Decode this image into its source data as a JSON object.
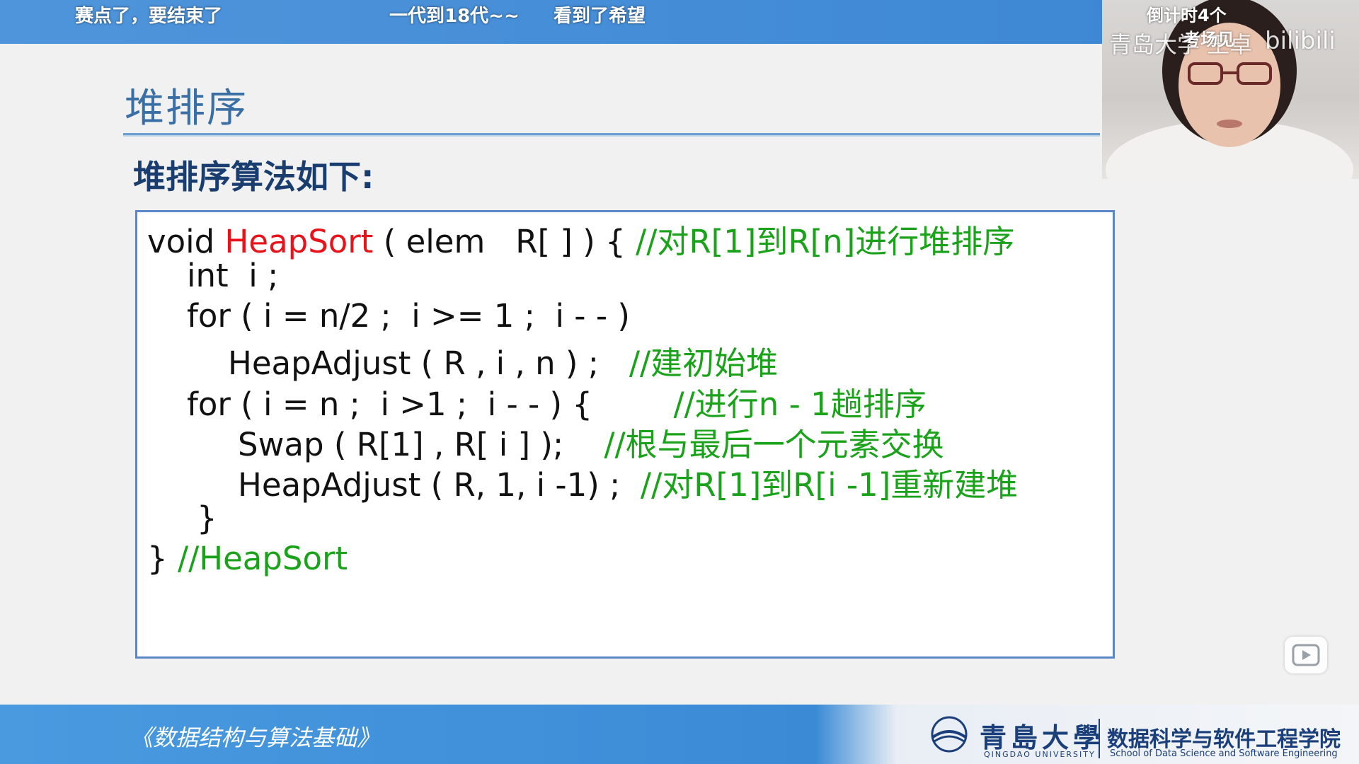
{
  "danmaku": [
    "赛点了，要结束了",
    "一代到18代~~",
    "看到了希望",
    "倒计时4个",
    "考场见"
  ],
  "slide": {
    "title": "堆排序",
    "subtitle": "堆排序算法如下:",
    "code": [
      {
        "segments": [
          {
            "text": "void ",
            "color": "black"
          },
          {
            "text": "HeapSort",
            "color": "red"
          },
          {
            "text": " ( elem   R[ ] ) { ",
            "color": "black"
          },
          {
            "text": "//对R[1]到R[n]进行堆排序",
            "color": "green"
          }
        ]
      },
      {
        "segments": [
          {
            "text": "int  i ;",
            "color": "black"
          }
        ]
      },
      {
        "segments": [
          {
            "text": "for ( i = n/2 ;  i >= 1 ;  i - - )",
            "color": "black"
          }
        ]
      },
      {
        "segments": [
          {
            "text": "HeapAdjust ( R , i , n ) ;   ",
            "color": "black"
          },
          {
            "text": "//建初始堆",
            "color": "green"
          }
        ]
      },
      {
        "segments": [
          {
            "text": "for ( i = n ;  i >1 ;  i - - ) {        ",
            "color": "black"
          },
          {
            "text": "//进行n - 1趟排序",
            "color": "green"
          }
        ]
      },
      {
        "segments": [
          {
            "text": "Swap ( R[1] , R[ i ] );    ",
            "color": "black"
          },
          {
            "text": "//根与最后一个元素交换",
            "color": "green"
          }
        ]
      },
      {
        "segments": [
          {
            "text": "HeapAdjust ( R, 1, i -1) ;  ",
            "color": "black"
          },
          {
            "text": "//对R[1]到R[i -1]重新建堆",
            "color": "green"
          }
        ]
      },
      {
        "segments": [
          {
            "text": "}",
            "color": "black"
          }
        ]
      },
      {
        "segments": [
          {
            "text": "} ",
            "color": "black"
          },
          {
            "text": "//HeapSort",
            "color": "green"
          }
        ]
      }
    ]
  },
  "webcam": {
    "overlay_text": "青岛大学 王卓",
    "logo_text": "bilibili"
  },
  "footer": {
    "book_title": "《数据结构与算法基础》",
    "university_cn": "青島大學",
    "university_en": "QINGDAO UNIVERSITY",
    "school_cn": "数据科学与软件工程学院",
    "school_en": "School of Data Science and Software Engineering"
  },
  "colors": {
    "title": "#3a6fa6",
    "code_red": "#e8121a",
    "code_green": "#1aa21a",
    "bar_blue": "#3a8ad6"
  }
}
